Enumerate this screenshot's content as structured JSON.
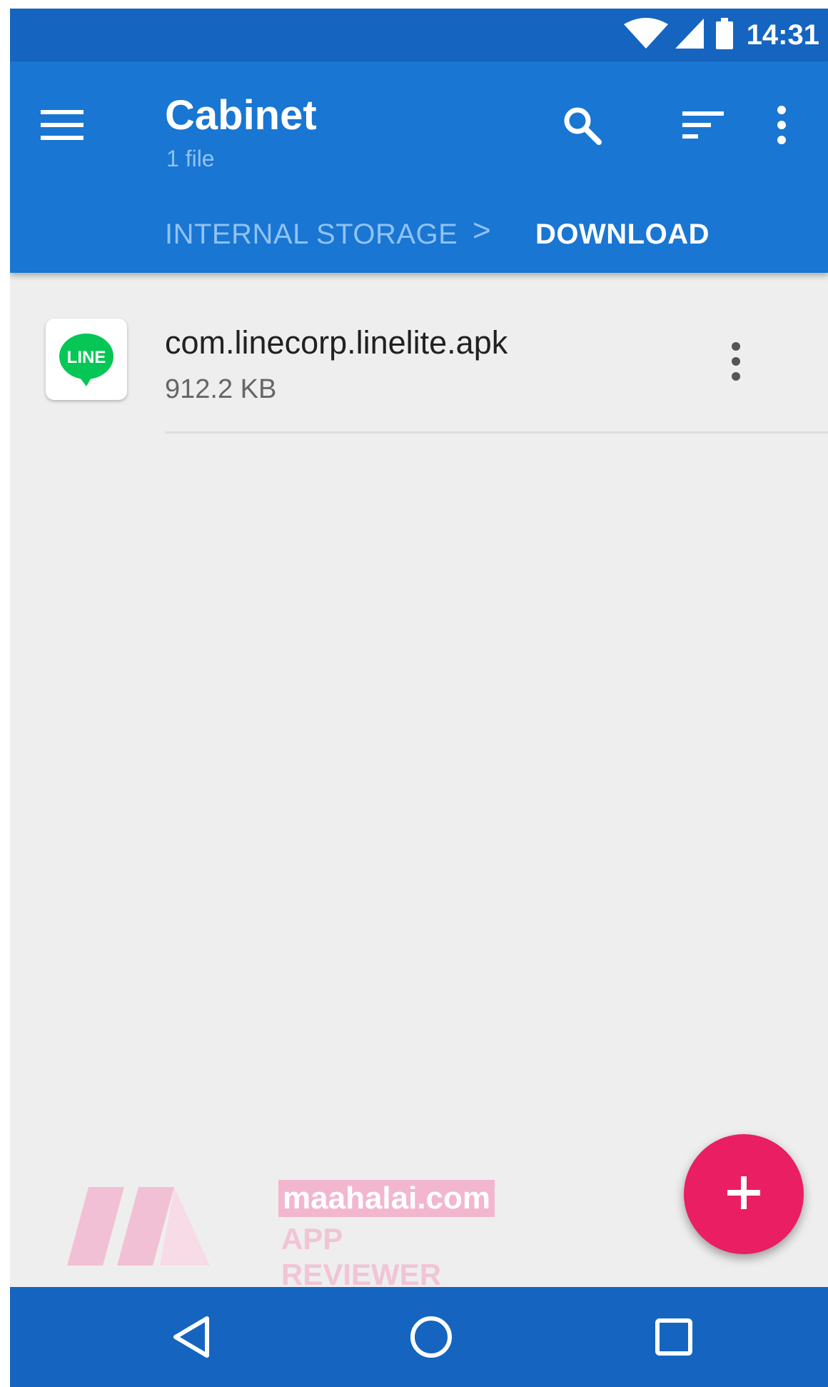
{
  "status_bar": {
    "time": "14:31"
  },
  "app_bar": {
    "title": "Cabinet",
    "subtitle": "1 file",
    "breadcrumb": [
      {
        "label": "INTERNAL STORAGE"
      },
      {
        "label": "DOWNLOAD"
      }
    ],
    "breadcrumb_separator": ">",
    "icons": [
      "menu-icon",
      "search-icon",
      "sort-icon",
      "more-vert-icon"
    ]
  },
  "files": [
    {
      "name": "com.linecorp.linelite.apk",
      "size": "912.2 KB",
      "icon": "line-app-icon",
      "icon_text": "LINE"
    }
  ],
  "fab": {
    "icon": "plus-icon"
  },
  "nav_bar": {
    "icons": [
      "back-icon",
      "home-icon",
      "recents-icon"
    ]
  },
  "watermark": {
    "line1": "maahalai.com",
    "line2": "APP REVIEWER"
  },
  "colors": {
    "primary": "#1976d2",
    "primary_dark": "#1565c0",
    "accent": "#e91e63",
    "background": "#eeeeee",
    "line_green": "#06c755"
  }
}
